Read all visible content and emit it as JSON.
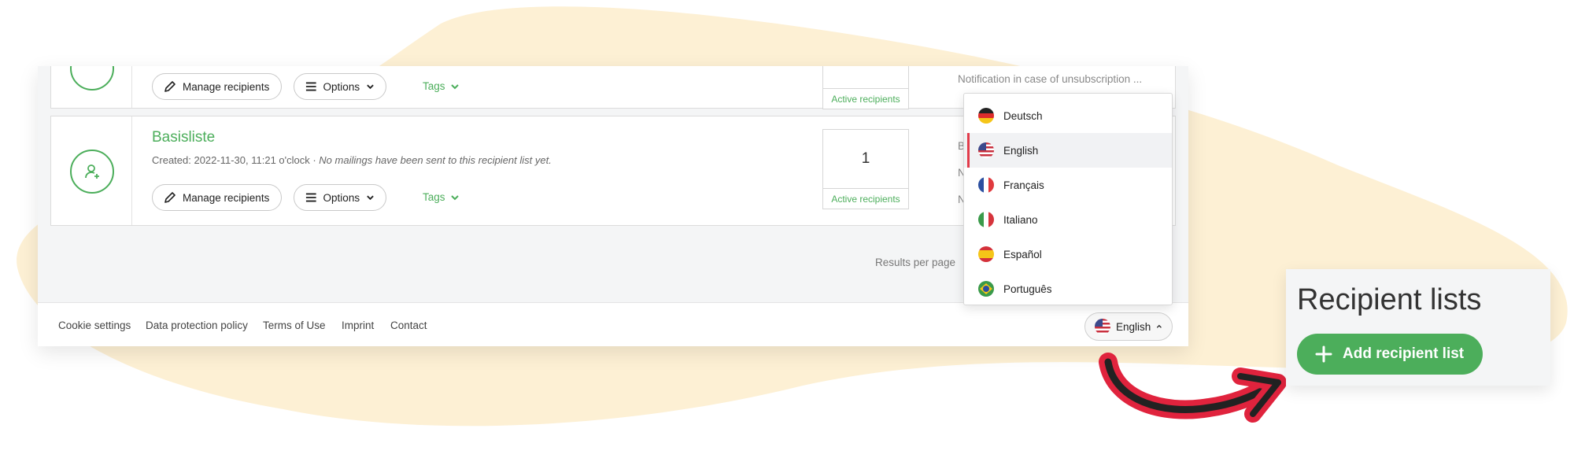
{
  "top_card": {
    "manage_label": "Manage recipients",
    "options_label": "Options",
    "tags_label": "Tags",
    "active_label": "Active recipients",
    "notification_text": "Notification in case of unsubscription ..."
  },
  "list_card": {
    "title": "Basisliste",
    "created": "Created: 2022-11-30, 11:21 o'clock · ",
    "note": "No mailings have been sent to this recipient list yet.",
    "manage_label": "Manage recipients",
    "options_label": "Options",
    "tags_label": "Tags",
    "active_count": "1",
    "active_label": "Active recipients",
    "side_texts": [
      "Blac",
      "Not",
      "Not"
    ]
  },
  "results_per_page": "Results per page",
  "footer": {
    "links": [
      "Cookie settings",
      "Data protection policy",
      "Terms of Use",
      "Imprint",
      "Contact"
    ],
    "language_label": "English"
  },
  "language_menu": {
    "items": [
      {
        "label": "Deutsch",
        "flag": "de-flag-icon"
      },
      {
        "label": "English",
        "flag": "us-flag-icon",
        "selected": true
      },
      {
        "label": "Français",
        "flag": "fr-flag-icon"
      },
      {
        "label": "Italiano",
        "flag": "it-flag-icon"
      },
      {
        "label": "Español",
        "flag": "es-flag-icon"
      },
      {
        "label": "Português",
        "flag": "br-flag-icon"
      }
    ]
  },
  "side_panel": {
    "title": "Recipient lists",
    "add_button": "Add recipient list"
  },
  "colors": {
    "accent_green": "#4cae5b",
    "blob_yellow": "#fdf0d4",
    "arrow_red": "#e0233d",
    "selected_marker": "#e23b4a"
  }
}
